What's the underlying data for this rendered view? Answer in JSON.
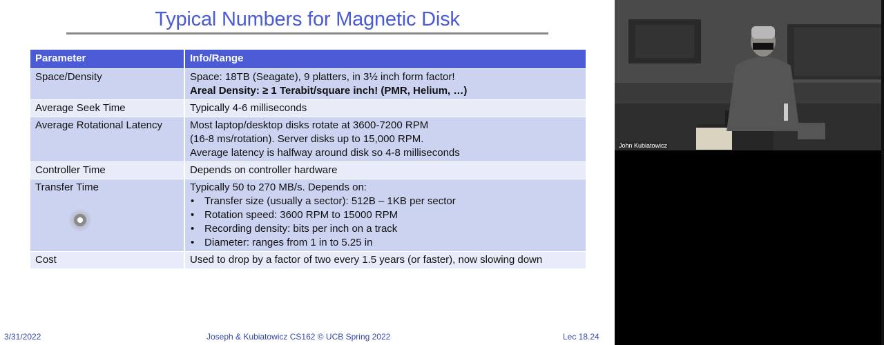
{
  "slide": {
    "title": "Typical Numbers for Magnetic Disk",
    "table": {
      "headers": [
        "Parameter",
        "Info/Range"
      ],
      "rows": [
        {
          "param": "Space/Density",
          "lines": [
            "Space: 18TB (Seagate), 9 platters, in 3½ inch form factor!"
          ],
          "bold_line": "Areal Density: ≥ 1 Terabit/square inch! (PMR, Helium, …)"
        },
        {
          "param": "Average Seek Time",
          "lines": [
            "Typically 4-6 milliseconds"
          ]
        },
        {
          "param": "Average Rotational Latency",
          "lines": [
            "Most laptop/desktop disks rotate at 3600-7200 RPM",
            "(16-8 ms/rotation). Server disks up to 15,000 RPM.",
            "Average latency is halfway around disk so 4-8 milliseconds"
          ]
        },
        {
          "param": "Controller Time",
          "lines": [
            "Depends on controller hardware"
          ]
        },
        {
          "param": "Transfer Time",
          "lines": [
            "Typically 50 to 270 MB/s. Depends on:"
          ],
          "bullets": [
            "Transfer size (usually a sector): 512B – 1KB per sector",
            "Rotation speed: 3600 RPM to 15000 RPM",
            "Recording density: bits per inch on a track",
            "Diameter: ranges from  1 in to 5.25 in"
          ]
        },
        {
          "param": "Cost",
          "lines": [
            "Used to drop by a factor of two every 1.5 years (or faster), now slowing down"
          ]
        }
      ]
    },
    "footer": {
      "date": "3/31/2022",
      "center": "Joseph & Kubiatowicz CS162 © UCB Spring 2022",
      "lecture": "Lec 18.24"
    }
  },
  "video": {
    "speaker_name": "John Kubiatowicz"
  },
  "colors": {
    "accent": "#4b5bd6",
    "band_dark": "#ccd3f0",
    "band_light": "#e8ebf8",
    "footer_text": "#3347a8"
  }
}
